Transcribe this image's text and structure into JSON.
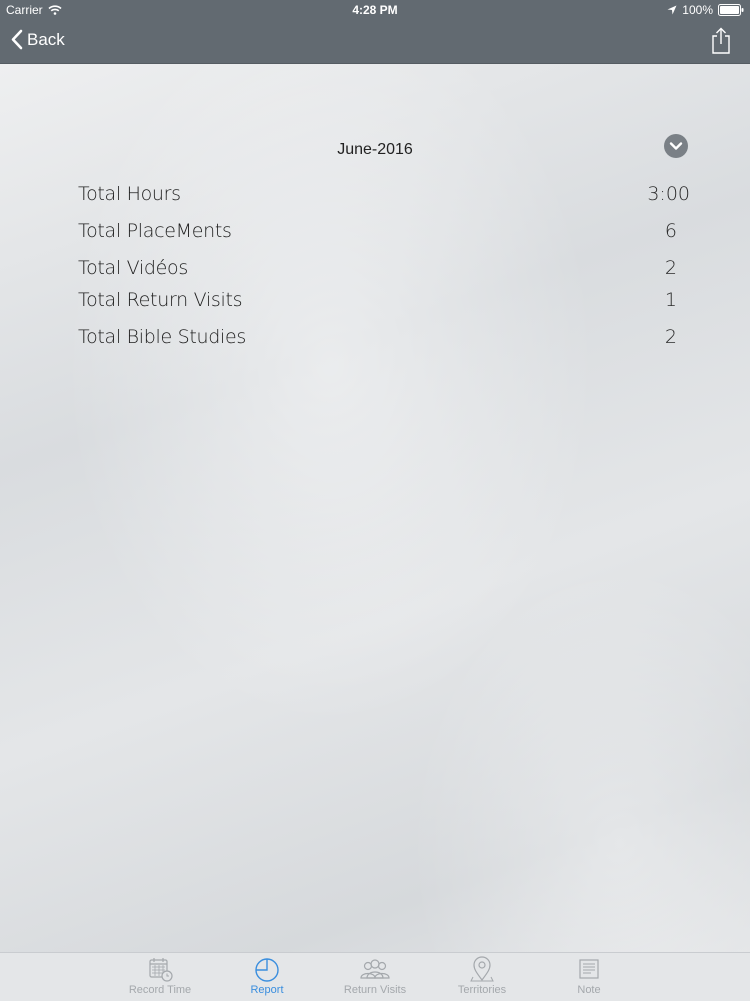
{
  "status_bar": {
    "carrier": "Carrier",
    "time": "4:28 PM",
    "battery": "100%"
  },
  "nav": {
    "back_label": "Back",
    "share_icon": "share-icon"
  },
  "report": {
    "month": "June-2016",
    "stats": [
      {
        "label": "Total Hours",
        "value": "3:00"
      },
      {
        "label": "Total PlaceMents",
        "value": "6"
      },
      {
        "label": "Total Vidéos",
        "value": "2"
      },
      {
        "label": "Total Return Visits",
        "value": "1"
      },
      {
        "label": "Total Bible Studies",
        "value": "2"
      }
    ]
  },
  "tabs": [
    {
      "label": "Record Time",
      "icon": "calendar-clock-icon",
      "active": false
    },
    {
      "label": "Report",
      "icon": "pie-chart-icon",
      "active": true
    },
    {
      "label": "Return Visits",
      "icon": "people-icon",
      "active": false
    },
    {
      "label": "Territories",
      "icon": "map-pin-icon",
      "active": false
    },
    {
      "label": "Note",
      "icon": "note-icon",
      "active": false
    }
  ],
  "colors": {
    "nav_bg": "#626a71",
    "tab_active": "#3a8ede",
    "tab_inactive": "#a4a8ac"
  }
}
